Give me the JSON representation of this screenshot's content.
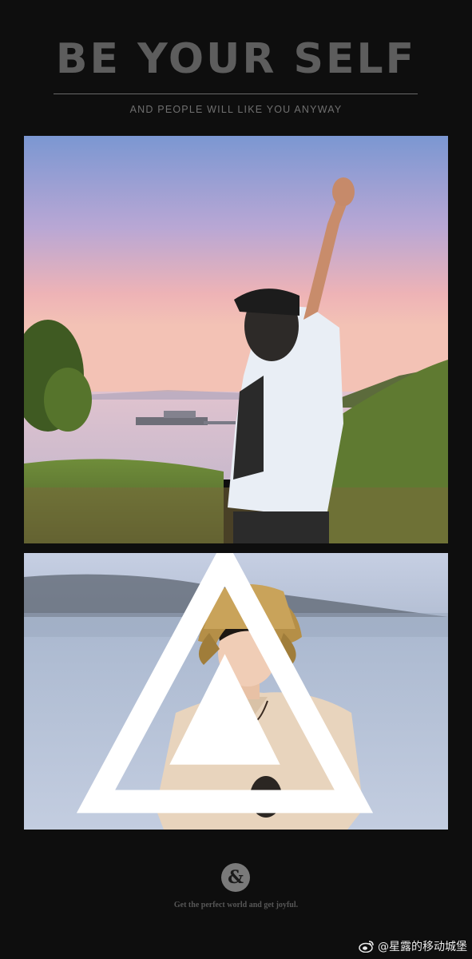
{
  "header": {
    "title": "BE YOUR SELF",
    "subtitle": "AND PEOPLE WILL LIKE YOU ANYWAY"
  },
  "photos": [
    {
      "subject": "person raising fist at sunset over sea"
    },
    {
      "subject": "person in bucket hat by the sea"
    }
  ],
  "footer": {
    "ampersand": "&",
    "tagline": "Get the perfect world and get joyful.",
    "watermark": "@星露的移动城堡"
  },
  "colors": {
    "background": "#0e0e0e",
    "title": "#5d5d5d",
    "subtitle": "#6f6f6f"
  }
}
